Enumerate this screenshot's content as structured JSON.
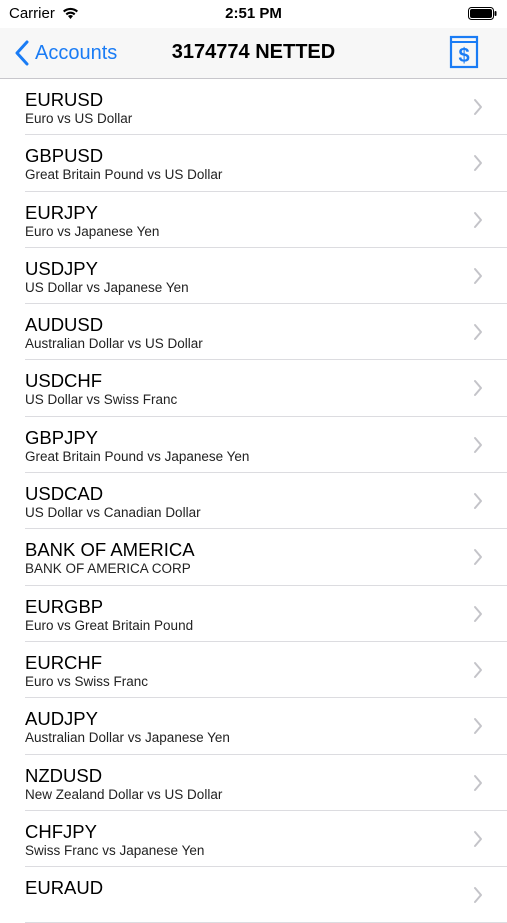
{
  "status_bar": {
    "carrier": "Carrier",
    "time": "2:51 PM"
  },
  "nav": {
    "back_label": "Accounts",
    "title": "3174774 NETTED",
    "accent_color": "#1a7cf5",
    "right_icon": "dollar-book-icon"
  },
  "instruments": [
    {
      "symbol": "EURUSD",
      "description": "Euro vs US Dollar"
    },
    {
      "symbol": "GBPUSD",
      "description": "Great Britain Pound vs US Dollar"
    },
    {
      "symbol": "EURJPY",
      "description": "Euro vs Japanese Yen"
    },
    {
      "symbol": "USDJPY",
      "description": "US Dollar vs Japanese Yen"
    },
    {
      "symbol": "AUDUSD",
      "description": "Australian Dollar vs US Dollar"
    },
    {
      "symbol": "USDCHF",
      "description": "US Dollar vs Swiss Franc"
    },
    {
      "symbol": "GBPJPY",
      "description": "Great Britain Pound vs Japanese Yen"
    },
    {
      "symbol": "USDCAD",
      "description": "US Dollar vs Canadian Dollar"
    },
    {
      "symbol": "BANK OF AMERICA",
      "description": "BANK OF AMERICA CORP"
    },
    {
      "symbol": "EURGBP",
      "description": "Euro vs Great Britain Pound"
    },
    {
      "symbol": "EURCHF",
      "description": "Euro vs Swiss Franc"
    },
    {
      "symbol": "AUDJPY",
      "description": "Australian Dollar vs Japanese Yen"
    },
    {
      "symbol": "NZDUSD",
      "description": "New Zealand Dollar vs US Dollar"
    },
    {
      "symbol": "CHFJPY",
      "description": "Swiss Franc vs Japanese Yen"
    },
    {
      "symbol": "EURAUD",
      "description": ""
    }
  ]
}
